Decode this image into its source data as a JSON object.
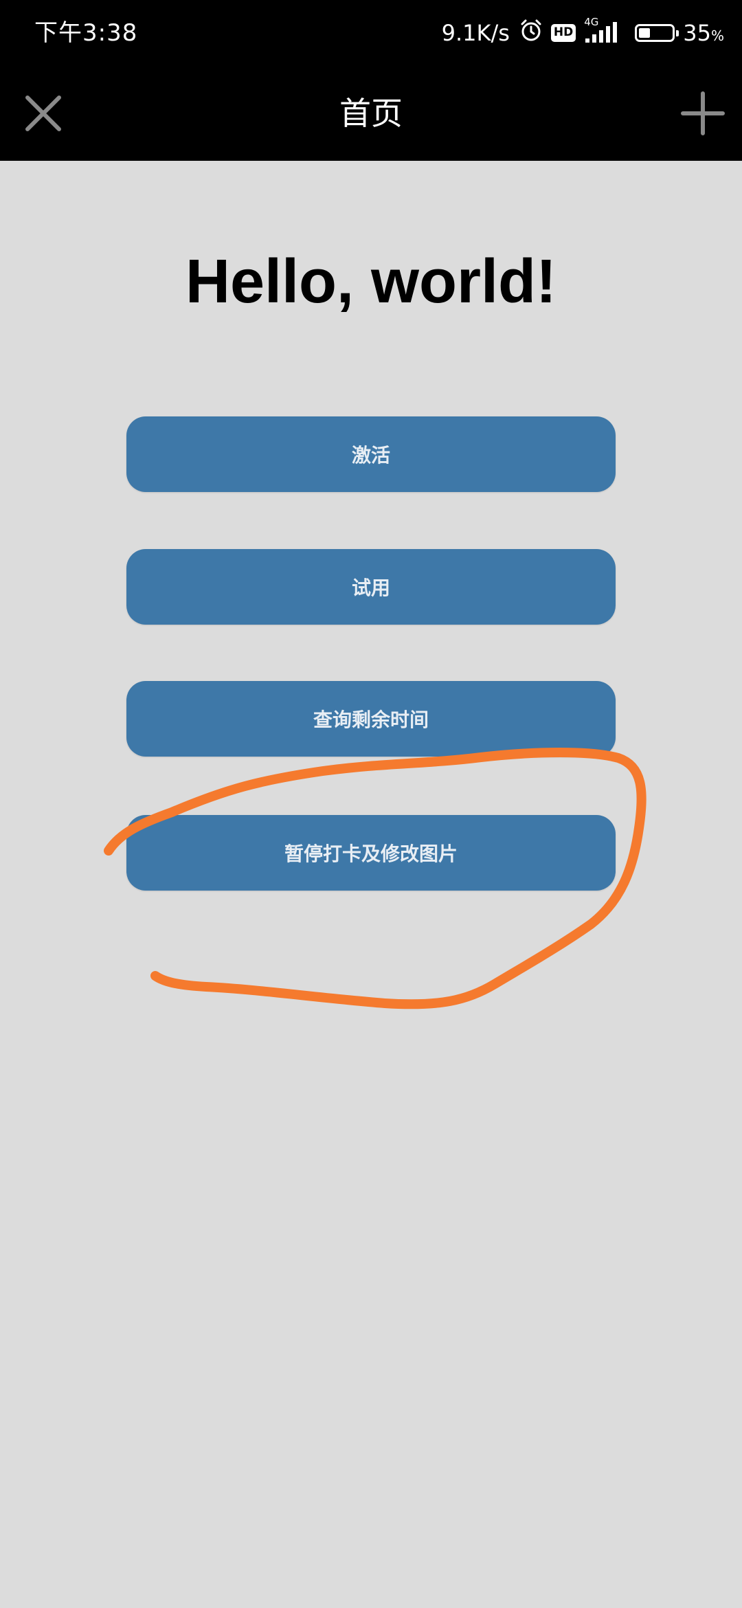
{
  "status_bar": {
    "time": "下午3:38",
    "net_speed": "9.1K/s",
    "hd_label": "HD",
    "network_type": "4G",
    "battery_level": 35,
    "battery_value": "35",
    "battery_unit": "%",
    "icons": [
      "alarm-clock-icon",
      "signal-bars-icon",
      "battery-icon"
    ]
  },
  "nav": {
    "title": "首页",
    "left_icon": "close-icon",
    "right_icon": "plus-icon"
  },
  "main": {
    "headline": "Hello, world!",
    "buttons": [
      {
        "label": "激活"
      },
      {
        "label": "试用"
      },
      {
        "label": "查询剩余时间"
      },
      {
        "label": "暂停打卡及修改图片"
      }
    ]
  },
  "annotation": {
    "color": "#f57a2e"
  }
}
